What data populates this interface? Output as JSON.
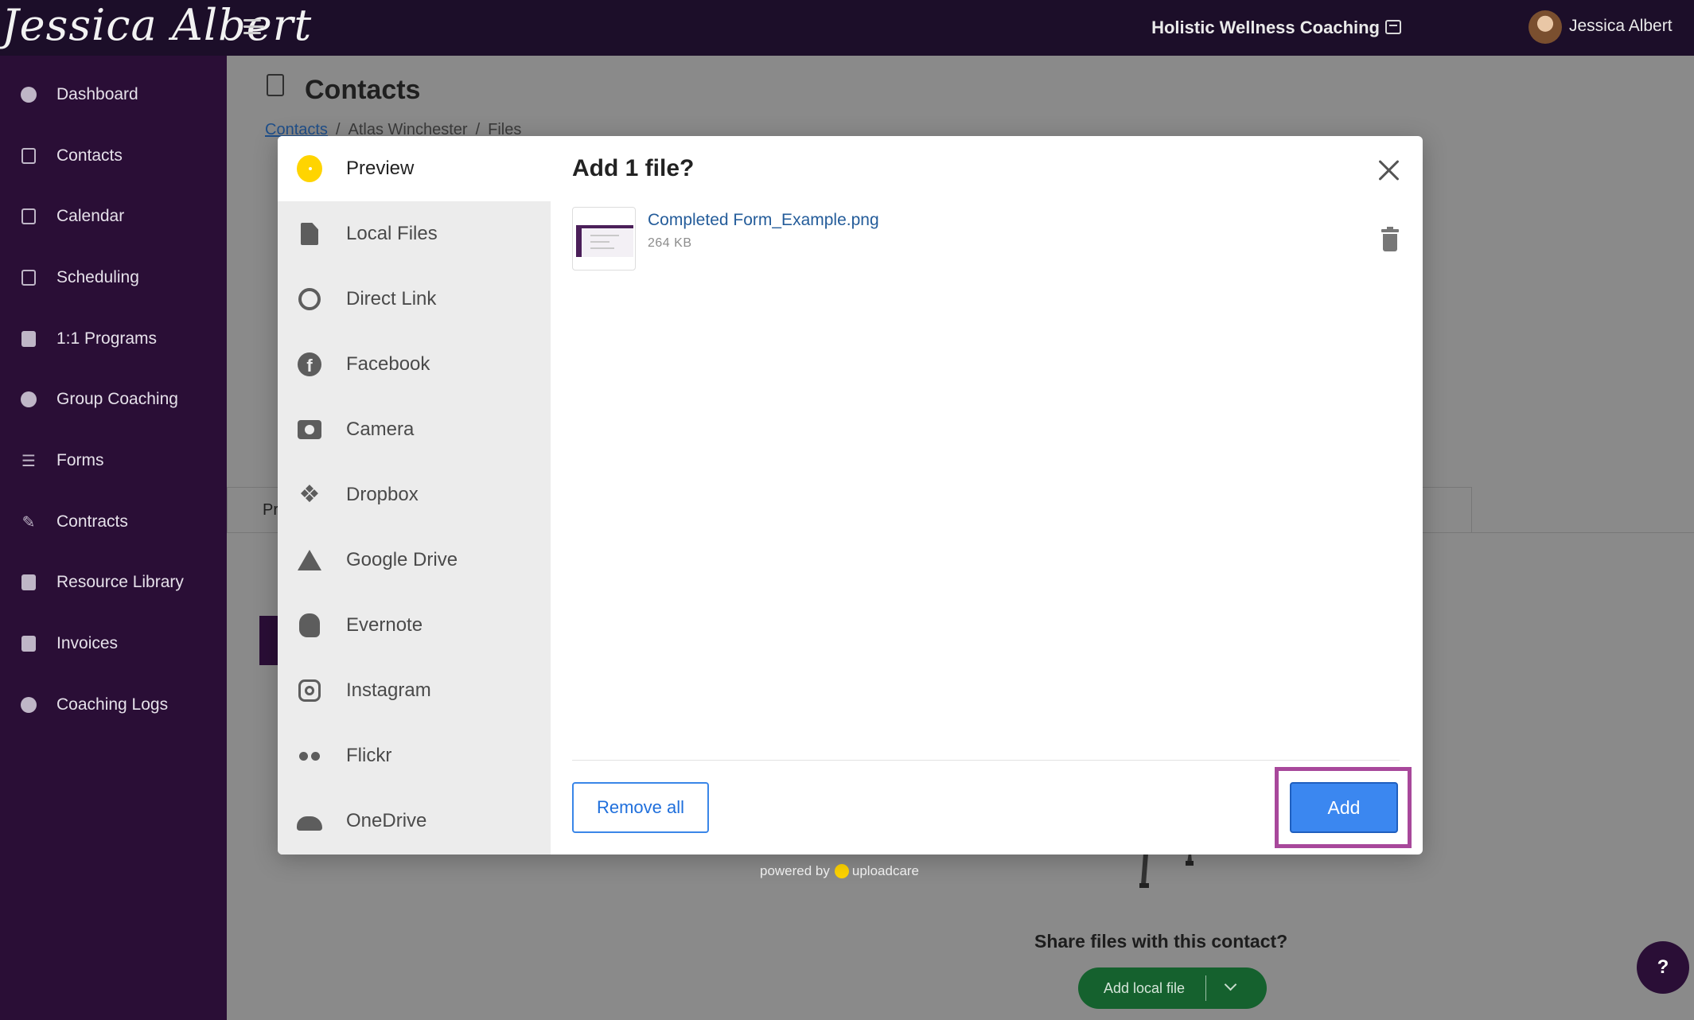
{
  "header": {
    "brand_signature": "Jessica Albert",
    "org_name": "Holistic Wellness Coaching",
    "user_name": "Jessica Albert"
  },
  "sidebar": {
    "items": [
      {
        "label": "Dashboard",
        "icon": "dashboard-icon"
      },
      {
        "label": "Contacts",
        "icon": "contacts-icon"
      },
      {
        "label": "Calendar",
        "icon": "calendar-icon"
      },
      {
        "label": "Scheduling",
        "icon": "scheduling-icon"
      },
      {
        "label": "1:1 Programs",
        "icon": "book-icon"
      },
      {
        "label": "Group Coaching",
        "icon": "group-icon"
      },
      {
        "label": "Forms",
        "icon": "forms-icon"
      },
      {
        "label": "Contracts",
        "icon": "contract-icon"
      },
      {
        "label": "Resource Library",
        "icon": "library-icon"
      },
      {
        "label": "Invoices",
        "icon": "invoice-icon"
      },
      {
        "label": "Coaching Logs",
        "icon": "clock-icon"
      }
    ]
  },
  "page": {
    "title": "Contacts",
    "breadcrumb": [
      "Contacts",
      "Atlas Winchester",
      "Files"
    ],
    "breadcrumb_sep": "/",
    "tab_partial": "Pr",
    "share_title": "Share files with this contact?",
    "share_button": "Add local file",
    "help_label": "?"
  },
  "modal": {
    "title": "Add 1 file?",
    "sources": [
      {
        "label": "Preview",
        "icon": "preview-dot-icon",
        "active": true
      },
      {
        "label": "Local Files",
        "icon": "file-icon"
      },
      {
        "label": "Direct Link",
        "icon": "link-icon"
      },
      {
        "label": "Facebook",
        "icon": "facebook-icon"
      },
      {
        "label": "Camera",
        "icon": "camera-icon"
      },
      {
        "label": "Dropbox",
        "icon": "dropbox-icon"
      },
      {
        "label": "Google Drive",
        "icon": "google-drive-icon"
      },
      {
        "label": "Evernote",
        "icon": "evernote-icon"
      },
      {
        "label": "Instagram",
        "icon": "instagram-icon"
      },
      {
        "label": "Flickr",
        "icon": "flickr-icon"
      },
      {
        "label": "OneDrive",
        "icon": "onedrive-icon"
      }
    ],
    "file": {
      "name": "Completed Form_Example.png",
      "size": "264 KB"
    },
    "remove_all_label": "Remove all",
    "add_label": "Add",
    "powered_by": "powered by",
    "powered_brand": "uploadcare"
  },
  "colors": {
    "topbar": "#1c0e29",
    "sidebar": "#2a0e36",
    "accent_blue": "#3b87f0",
    "highlight": "#a8489b",
    "uploadcare_yellow": "#ffd400",
    "share_green": "#15612e"
  }
}
